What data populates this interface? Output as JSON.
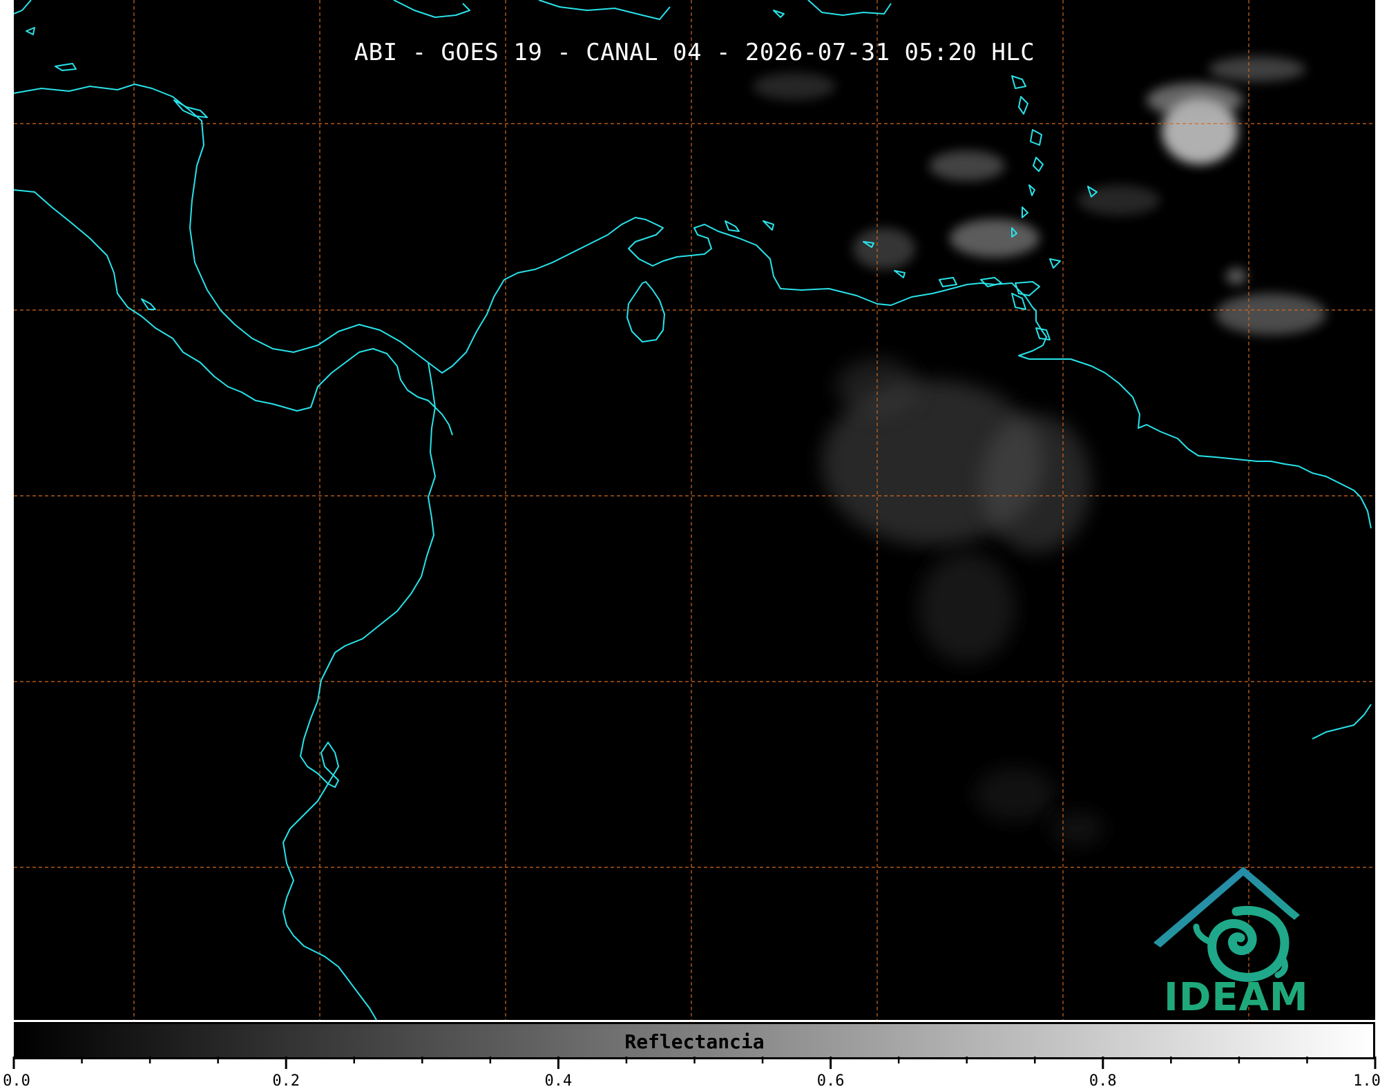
{
  "title": "ABI - GOES 19 - CANAL 04 - 2026-07-31 05:20 HLC",
  "logo": {
    "text": "IDEAM",
    "text_color": "#1fa97a",
    "roof_color": "#2a7fb8",
    "swirl_color": "#1fa98a"
  },
  "map": {
    "background_color": "#000000",
    "coastline_color": "#28e3ea",
    "graticule_color": "#d2691e",
    "graticule_style": "dashed",
    "cloud_color": "#8a8a8a"
  },
  "colorbar": {
    "label": "Reflectancia",
    "colormap": "grayscale",
    "min": 0.0,
    "max": 1.0,
    "major_ticks": [
      "0.0",
      "0.2",
      "0.4",
      "0.6",
      "0.8",
      "1.0"
    ],
    "major_tick_values": [
      0.0,
      0.2,
      0.4,
      0.6,
      0.8,
      1.0
    ],
    "minor_tick_step": 0.05
  }
}
